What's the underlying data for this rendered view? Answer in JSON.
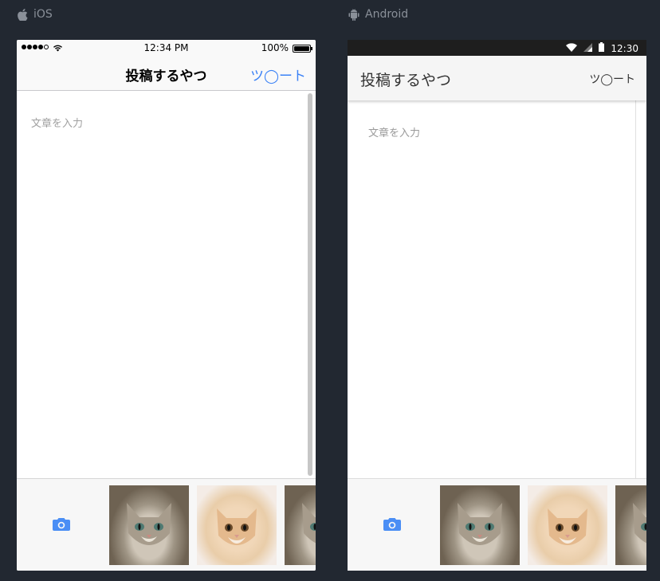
{
  "ios_section": {
    "label": "iOS",
    "icon": "apple-icon"
  },
  "android_section": {
    "label": "Android",
    "icon": "android-icon"
  },
  "ios": {
    "status": {
      "time": "12:34 PM",
      "battery": "100%",
      "battery_level": 1.0
    },
    "nav": {
      "title": "投稿するやつ",
      "tweet_label": "ツ◯ート"
    },
    "input": {
      "placeholder": "文章を入力"
    },
    "photos": [
      "cat-photo-tabby",
      "cat-photo-ginger",
      "cat-photo-tabby"
    ]
  },
  "android": {
    "status": {
      "time": "12:30"
    },
    "appbar": {
      "title": "投稿するやつ",
      "tweet_label": "ツ◯ート"
    },
    "input": {
      "placeholder": "文章を入力"
    },
    "photos": [
      "cat-photo-tabby",
      "cat-photo-ginger",
      "cat-photo-tabby"
    ]
  },
  "colors": {
    "accent": "#3b82f6",
    "background": "#222831",
    "label": "#8a9099"
  }
}
